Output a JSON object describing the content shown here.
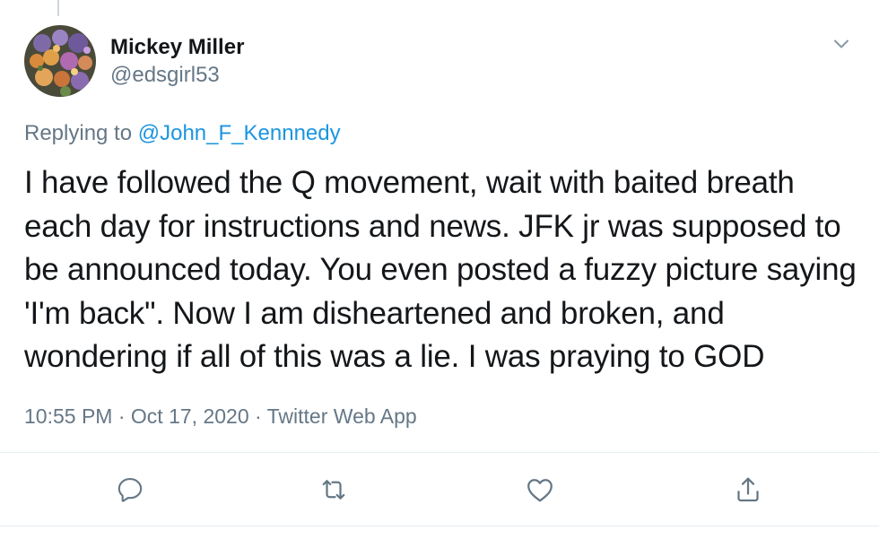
{
  "tweet": {
    "display_name": "Mickey Miller",
    "handle": "@edsgirl53",
    "replying_prefix": "Replying to ",
    "replying_to": "@John_F_Kennnedy",
    "text": "I have followed the Q movement, wait with baited breath each day for instructions and news. JFK jr was supposed to be announced today. You even posted a fuzzy picture saying 'I'm back\". Now I am disheartened and broken, and wondering if all of this was a lie. I was praying to GOD",
    "time": "10:55 PM",
    "separator": "·",
    "date": "Oct 17, 2020",
    "source": "Twitter Web App"
  },
  "icons": {
    "menu": "chevron-down-icon",
    "reply": "reply-icon",
    "retweet": "retweet-icon",
    "like": "like-icon",
    "share": "share-icon"
  },
  "colors": {
    "text": "#14171a",
    "secondary": "#657786",
    "link": "#1b95e0",
    "border": "#e6ecf0",
    "icon": "#657786"
  }
}
